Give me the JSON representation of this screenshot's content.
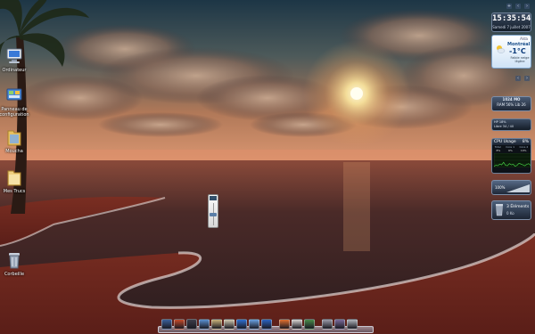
{
  "desktop": {
    "icons": [
      {
        "label": "Ordinateur",
        "icon": "computer-icon"
      },
      {
        "label": "Panneau de\nconfiguration",
        "icon": "control-panel-icon"
      },
      {
        "label": "Moucha",
        "icon": "folder-icon"
      },
      {
        "label": "Mes Trucs",
        "icon": "folder-icon"
      },
      {
        "label": "Corbeille",
        "icon": "recycle-bin-icon"
      }
    ]
  },
  "volume_slider": {
    "level": 0.5
  },
  "sidebar": {
    "clock": {
      "time": "15:35:54",
      "date": "Samedi 7 juillet 2007"
    },
    "weather": {
      "source": "Alda",
      "city": "Montréal",
      "temperature": "-1°C",
      "condition": "Faible neige légère"
    },
    "ram": {
      "line1": "1024 MO",
      "line2": "RAM 56% Lib 26"
    },
    "disk": {
      "label": "HP  18%",
      "detail": "Libre 34 / 40"
    },
    "cpu": {
      "title": "CPU Usage",
      "total": "8%",
      "columns": [
        "Total",
        "Core 1",
        "Core 2"
      ],
      "values": [
        "8%",
        "6%",
        "10%"
      ],
      "history": [
        3,
        5,
        4,
        8,
        6,
        12,
        5,
        4,
        9,
        6,
        7,
        3,
        5,
        10,
        8,
        6,
        4,
        7,
        9,
        5
      ]
    },
    "volume": {
      "percent": "100%",
      "level": 1.0
    },
    "recycle": {
      "count": "3",
      "unit": "Éléments",
      "size": "0 Ko"
    }
  },
  "dock": {
    "items": [
      {
        "icon": "app-icon-1",
        "color": "#3a5f9a"
      },
      {
        "icon": "app-icon-2",
        "color": "#c44a2a"
      },
      {
        "icon": "settings-icon",
        "color": "#3d3d4a"
      },
      {
        "icon": "app-icon-4",
        "color": "#5a8fd0"
      },
      {
        "icon": "app-icon-5",
        "color": "#c9b27a"
      },
      {
        "icon": "app-icon-6",
        "color": "#d0c8b0"
      },
      {
        "icon": "media-player-icon",
        "color": "#2f6fd0"
      },
      {
        "icon": "network-icon",
        "color": "#6aa0e0"
      },
      {
        "icon": "browser-icon",
        "color": "#2b62c0"
      },
      {
        "icon": "app-icon-10",
        "color": "#e07030"
      },
      {
        "icon": "app-icon-11",
        "color": "#d6d2d0"
      },
      {
        "icon": "app-icon-12",
        "color": "#4a8a4a"
      },
      {
        "icon": "app-icon-13",
        "color": "#9a9aa8"
      },
      {
        "icon": "app-icon-14",
        "color": "#7a6a9a"
      },
      {
        "icon": "trash-icon",
        "color": "#b0b4bc"
      }
    ]
  }
}
